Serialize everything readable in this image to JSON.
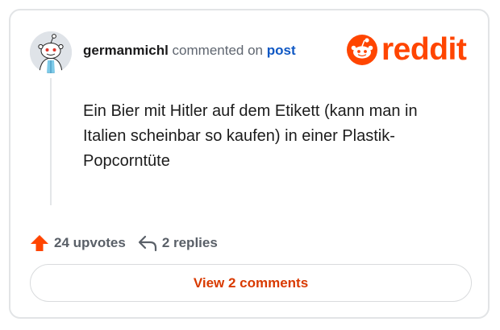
{
  "header": {
    "username": "germanmichl",
    "commented_text": "commented on",
    "post_link": "post"
  },
  "logo": {
    "text": "reddit",
    "icon": "reddit-snoo-icon",
    "color": "#ff4500"
  },
  "comment": {
    "body": "Ein Bier mit Hitler auf dem Etikett (kann man in Italien scheinbar so kaufen) in einer Plastik-Popcorntüte"
  },
  "actions": {
    "upvotes_label": "24 upvotes",
    "upvote_icon": "upvote-arrow-icon",
    "replies_label": "2 replies",
    "reply_icon": "reply-arrow-icon"
  },
  "view_comments_label": "View 2 comments",
  "colors": {
    "accent": "#ff4500",
    "link": "#0f58c4",
    "button_text": "#d93a00"
  }
}
